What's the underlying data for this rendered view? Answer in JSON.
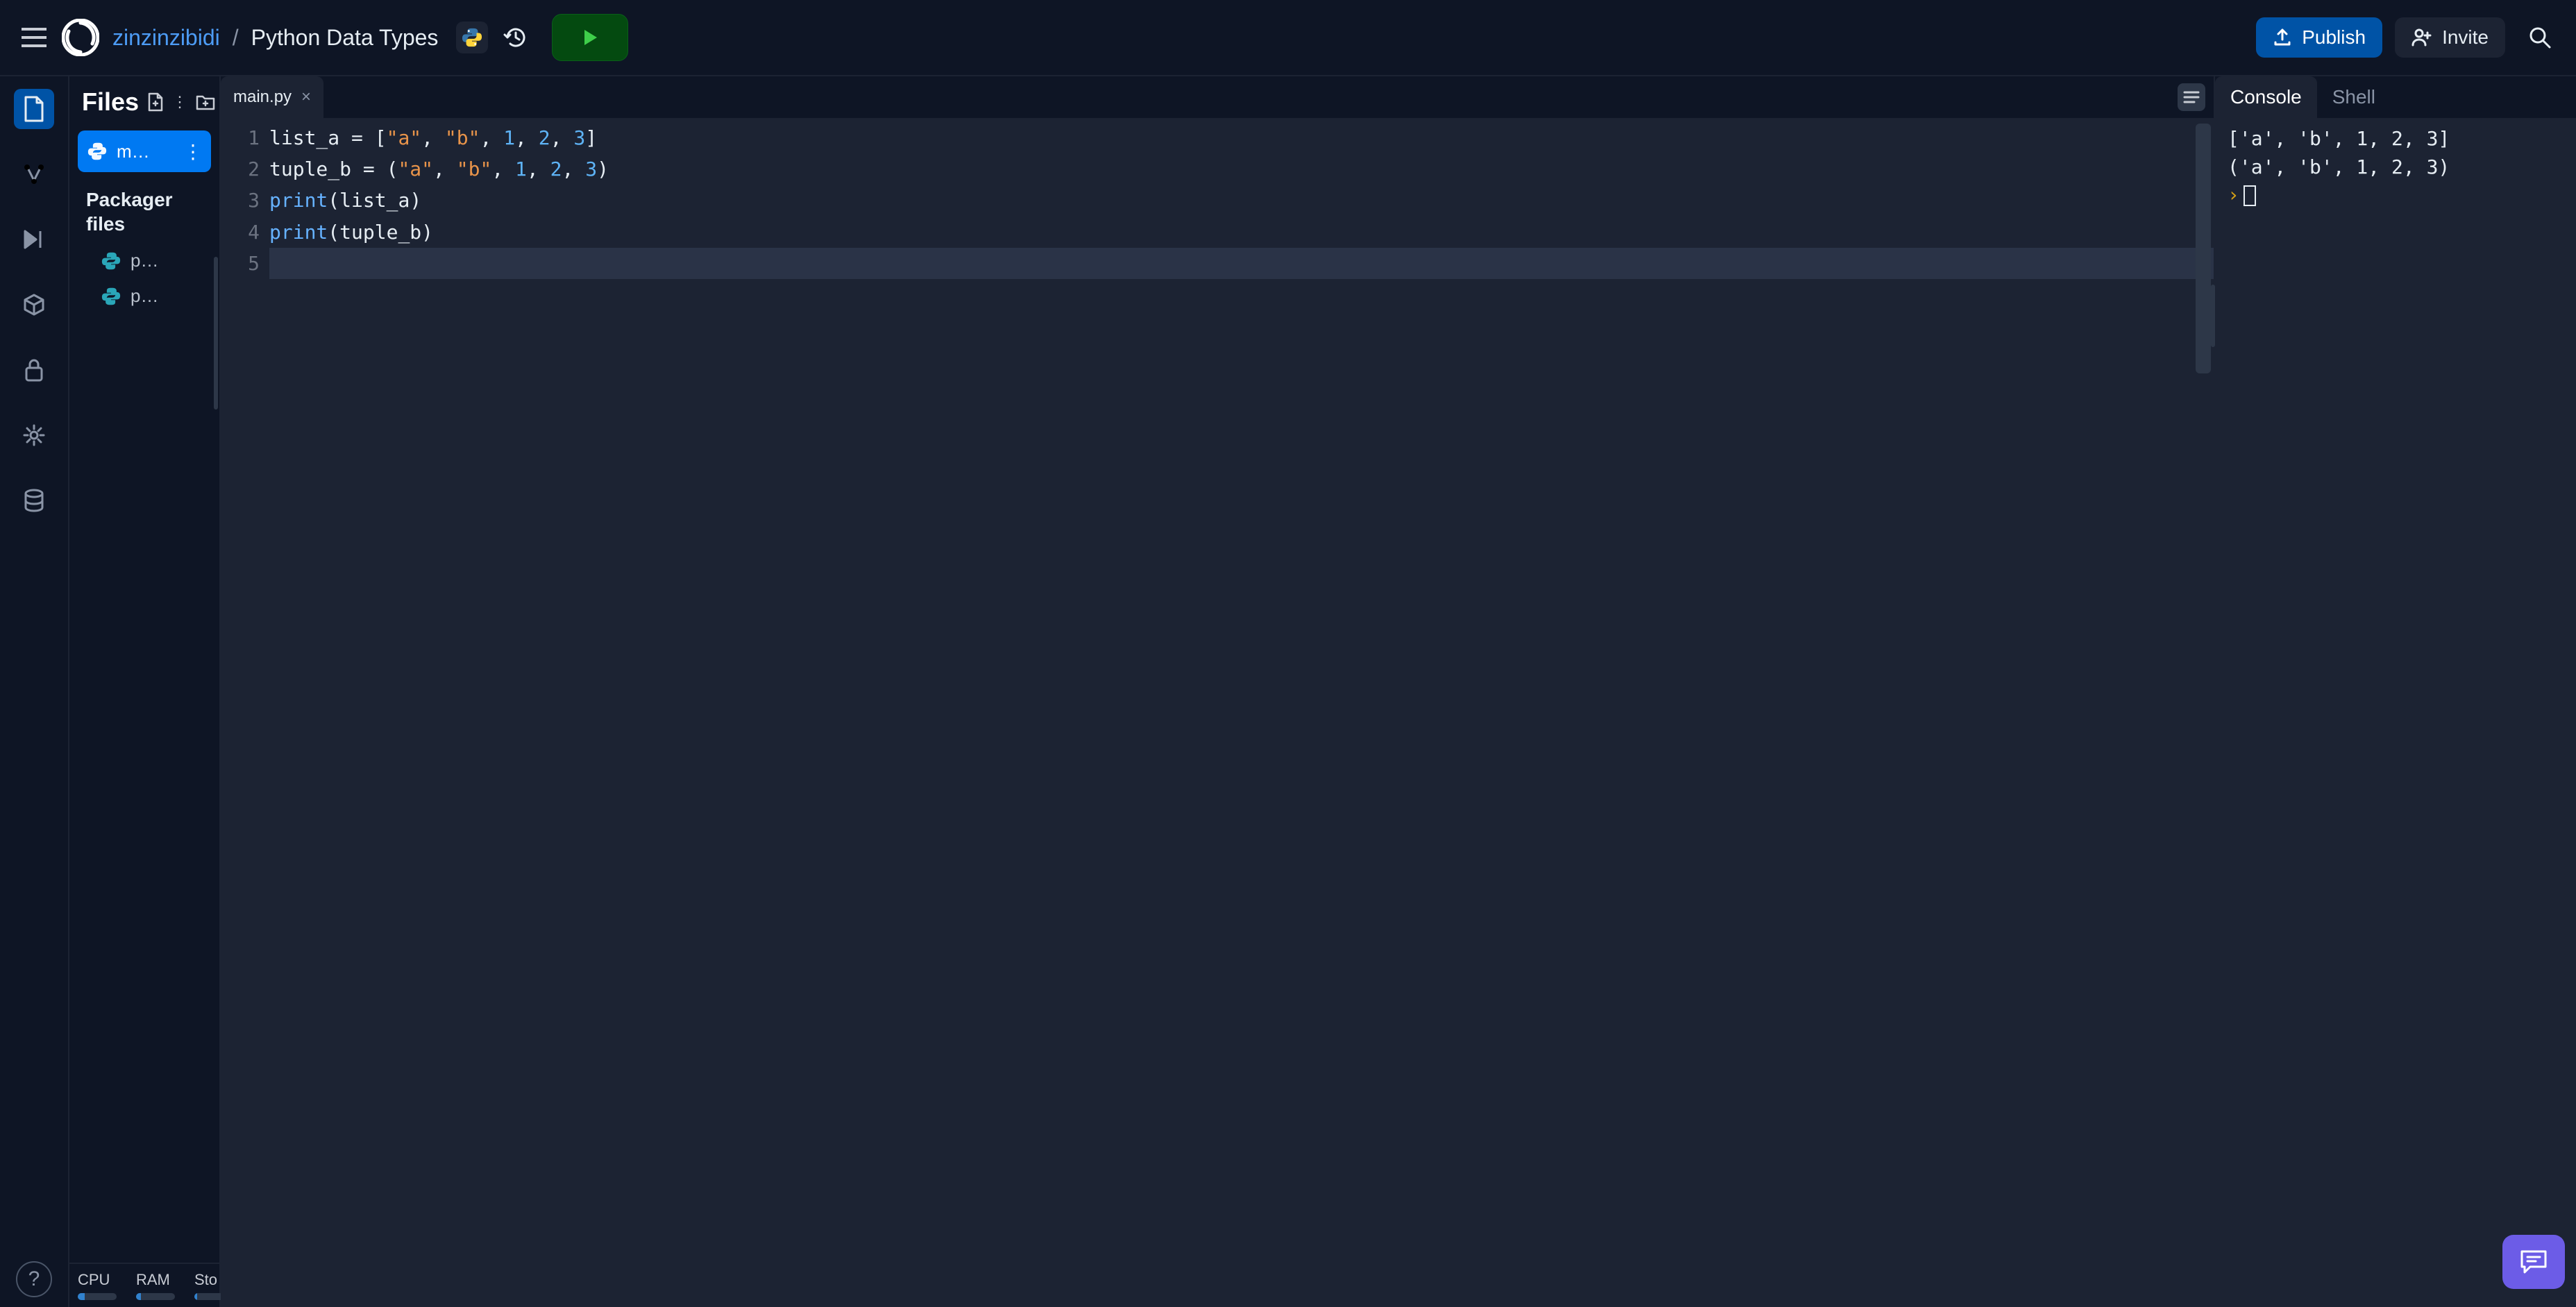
{
  "header": {
    "owner": "zinzinzibidi",
    "separator": "/",
    "project": "Python Data Types",
    "publish_label": "Publish",
    "invite_label": "Invite"
  },
  "rail": {
    "help_label": "?"
  },
  "sidebar": {
    "title": "Files",
    "selected_file": "m…",
    "section_title": "Packager files",
    "pkg_files": [
      "p…",
      "p…"
    ],
    "stats": {
      "cpu": {
        "label": "CPU",
        "pct": 18
      },
      "ram": {
        "label": "RAM",
        "pct": 12
      },
      "stor": {
        "label": "Sto",
        "pct": 8
      }
    }
  },
  "editor": {
    "tab": "main.py",
    "gutter": [
      "1",
      "2",
      "3",
      "4",
      "5"
    ],
    "code": {
      "l1": {
        "var": "list_a",
        "op": " = ",
        "open": "[",
        "s1": "\"a\"",
        "c1": ", ",
        "s2": "\"b\"",
        "c2": ", ",
        "n1": "1",
        "c3": ", ",
        "n2": "2",
        "c4": ", ",
        "n3": "3",
        "close": "]"
      },
      "l2": {
        "var": "tuple_b",
        "op": " = ",
        "open": "(",
        "s1": "\"a\"",
        "c1": ", ",
        "s2": "\"b\"",
        "c2": ", ",
        "n1": "1",
        "c3": ", ",
        "n2": "2",
        "c4": ", ",
        "n3": "3",
        "close": ")"
      },
      "l3": {
        "fn": "print",
        "open": "(",
        "arg": "list_a",
        "close": ")"
      },
      "l4": {
        "fn": "print",
        "open": "(",
        "arg": "tuple_b",
        "close": ")"
      }
    }
  },
  "right": {
    "tab_console": "Console",
    "tab_shell": "Shell",
    "output": "['a', 'b', 1, 2, 3]\n('a', 'b', 1, 2, 3)",
    "prompt": "›"
  }
}
